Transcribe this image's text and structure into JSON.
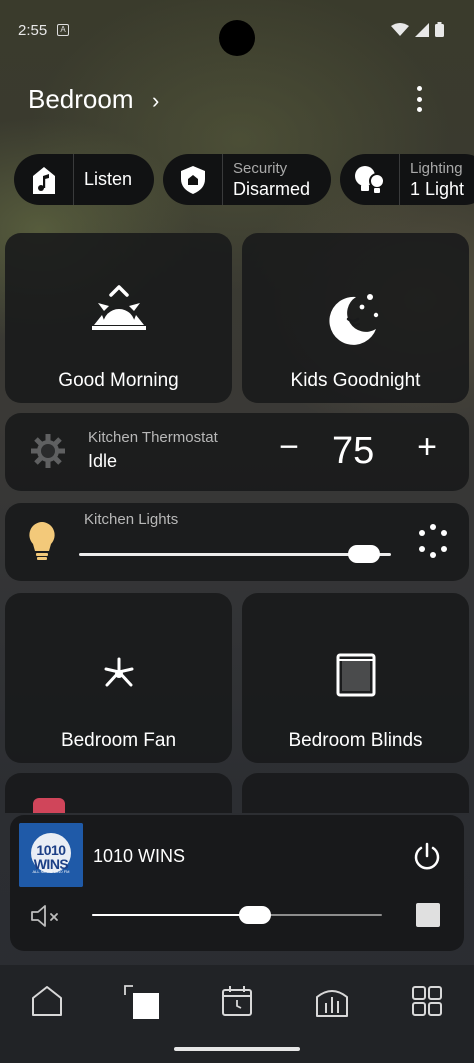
{
  "status_bar": {
    "time": "2:55",
    "sim_badge": "A"
  },
  "header": {
    "title": "Bedroom",
    "chevron": "›"
  },
  "chips": [
    {
      "icon": "music-note-icon",
      "label": "Listen"
    },
    {
      "icon": "shield-home-icon",
      "sub": "Security",
      "main": "Disarmed"
    },
    {
      "icon": "bulbs-icon",
      "sub": "Lighting",
      "main": "1 Light"
    }
  ],
  "scenes": [
    {
      "icon": "sunrise-icon",
      "label": "Good Morning"
    },
    {
      "icon": "moon-stars-icon",
      "label": "Kids Goodnight"
    }
  ],
  "thermostat": {
    "name": "Kitchen Thermostat",
    "state": "Idle",
    "minus": "−",
    "value": "75",
    "plus": "+"
  },
  "light": {
    "name": "Kitchen Lights",
    "level": 0.96,
    "color": "#f3c97a"
  },
  "devices": [
    {
      "icon": "ceiling-fan-icon",
      "label": "Bedroom Fan"
    },
    {
      "icon": "window-blinds-icon",
      "label": "Bedroom Blinds"
    }
  ],
  "player": {
    "station": "1010 WINS",
    "logo_text": "1010 WINS",
    "logo_sub": "ALL NEWS 1010 FM",
    "volume": 0.57,
    "muted": true
  },
  "nav": [
    {
      "icon": "home-icon"
    },
    {
      "icon": "rooms-icon",
      "active": true
    },
    {
      "icon": "calendar-clock-icon"
    },
    {
      "icon": "analytics-icon"
    },
    {
      "icon": "grid-icon"
    }
  ]
}
